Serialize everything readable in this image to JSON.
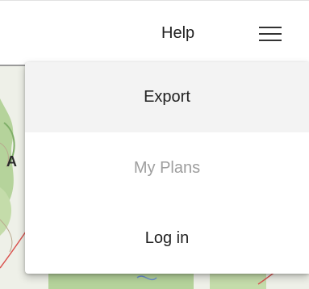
{
  "header": {
    "help_label": "Help",
    "menu_icon": "hamburger-menu-icon"
  },
  "map": {
    "visible_label": "A"
  },
  "menu": {
    "items": [
      {
        "label": "Export",
        "state": "hovered"
      },
      {
        "label": "My Plans",
        "state": "disabled"
      },
      {
        "label": "Log in",
        "state": "normal"
      }
    ]
  },
  "colors": {
    "text": "#212121",
    "disabled_text": "#9e9e9e",
    "hover_bg": "#f3f3f3",
    "map_green": "#a9c98f",
    "map_route_red": "#d9534f"
  }
}
